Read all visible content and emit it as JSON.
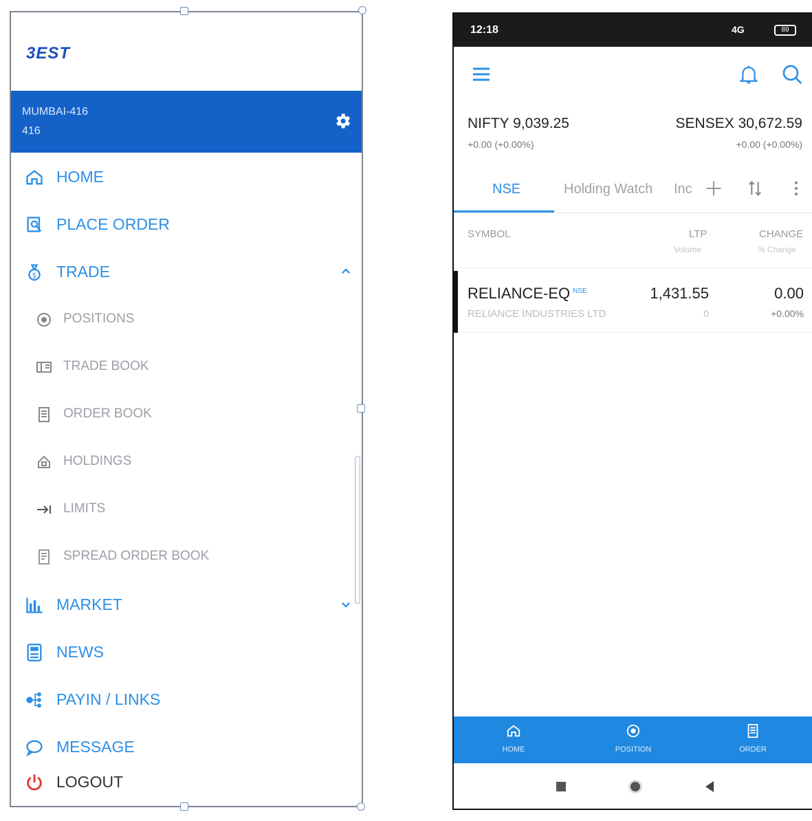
{
  "drawer": {
    "logo": "3EST",
    "account": {
      "line1": "MUMBAI-416",
      "line2": "416"
    },
    "menu": {
      "home": "HOME",
      "place_order": "PLACE ORDER",
      "trade": "TRADE",
      "market": "MARKET",
      "news": "NEWS",
      "payin": "PAYIN / LINKS",
      "message": "MESSAGE",
      "logout": "LOGOUT"
    },
    "trade_sub": {
      "positions": "POSITIONS",
      "trade_book": "TRADE BOOK",
      "order_book": "ORDER BOOK",
      "holdings": "HOLDINGS",
      "limits": "LIMITS",
      "spread_order_book": "SPREAD ORDER BOOK"
    },
    "colors": {
      "accent": "#2d8fe6",
      "header": "#1462c8",
      "logout_icon": "#e53935"
    }
  },
  "phone": {
    "status": {
      "time": "12:18",
      "signal": "4G",
      "battery": "89"
    },
    "indices": {
      "nifty": {
        "name": "NIFTY",
        "value": "9,039.25",
        "change": "+0.00 (+0.00%)"
      },
      "sensex": {
        "name": "SENSEX",
        "value": "30,672.59",
        "change": "+0.00 (+0.00%)"
      }
    },
    "tabs": [
      "NSE",
      "Holding Watch",
      "Inc"
    ],
    "columns": {
      "symbol": "SYMBOL",
      "ltp": "LTP",
      "volume": "Volume",
      "change": "CHANGE",
      "pct_change": "% Change"
    },
    "rows": [
      {
        "symbol": "RELIANCE-EQ",
        "exchange": "NSE",
        "company": "RELIANCE INDUSTRIES LTD",
        "ltp": "1,431.55",
        "volume": "0",
        "change": "0.00",
        "pct_change": "+0.00%"
      }
    ],
    "bottom_nav": [
      "HOME",
      "POSITION",
      "ORDER"
    ],
    "icons": [
      "menu-icon",
      "bell-icon",
      "search-icon",
      "plus-icon",
      "sort-icon",
      "more-vertical-icon"
    ]
  }
}
